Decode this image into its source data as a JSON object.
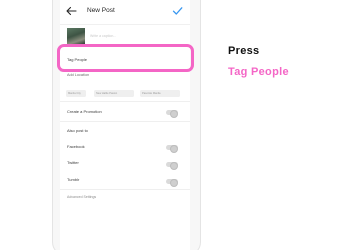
{
  "header": {
    "title": "New Post",
    "back_icon": "arrow-left-icon",
    "confirm_icon": "checkmark-icon",
    "accent_color": "#3897f0"
  },
  "caption": {
    "placeholder": "Write a caption..."
  },
  "rows": {
    "tag_people": "Tag People",
    "add_location": "Add Location",
    "location_suggestions": [
      "Manila City",
      "New Haltle Pasion",
      "Pasonite Manila"
    ],
    "create_promotion": "Create a Promotion",
    "also_post_to": "Also post to",
    "facebook": "Facebook",
    "twitter": "Twitter",
    "tumblr": "Tumblr",
    "advanced_settings": "Advanced Settings"
  },
  "instruction": {
    "line1": "Press",
    "line2": "Tag People",
    "highlight_color": "#f466c6"
  }
}
